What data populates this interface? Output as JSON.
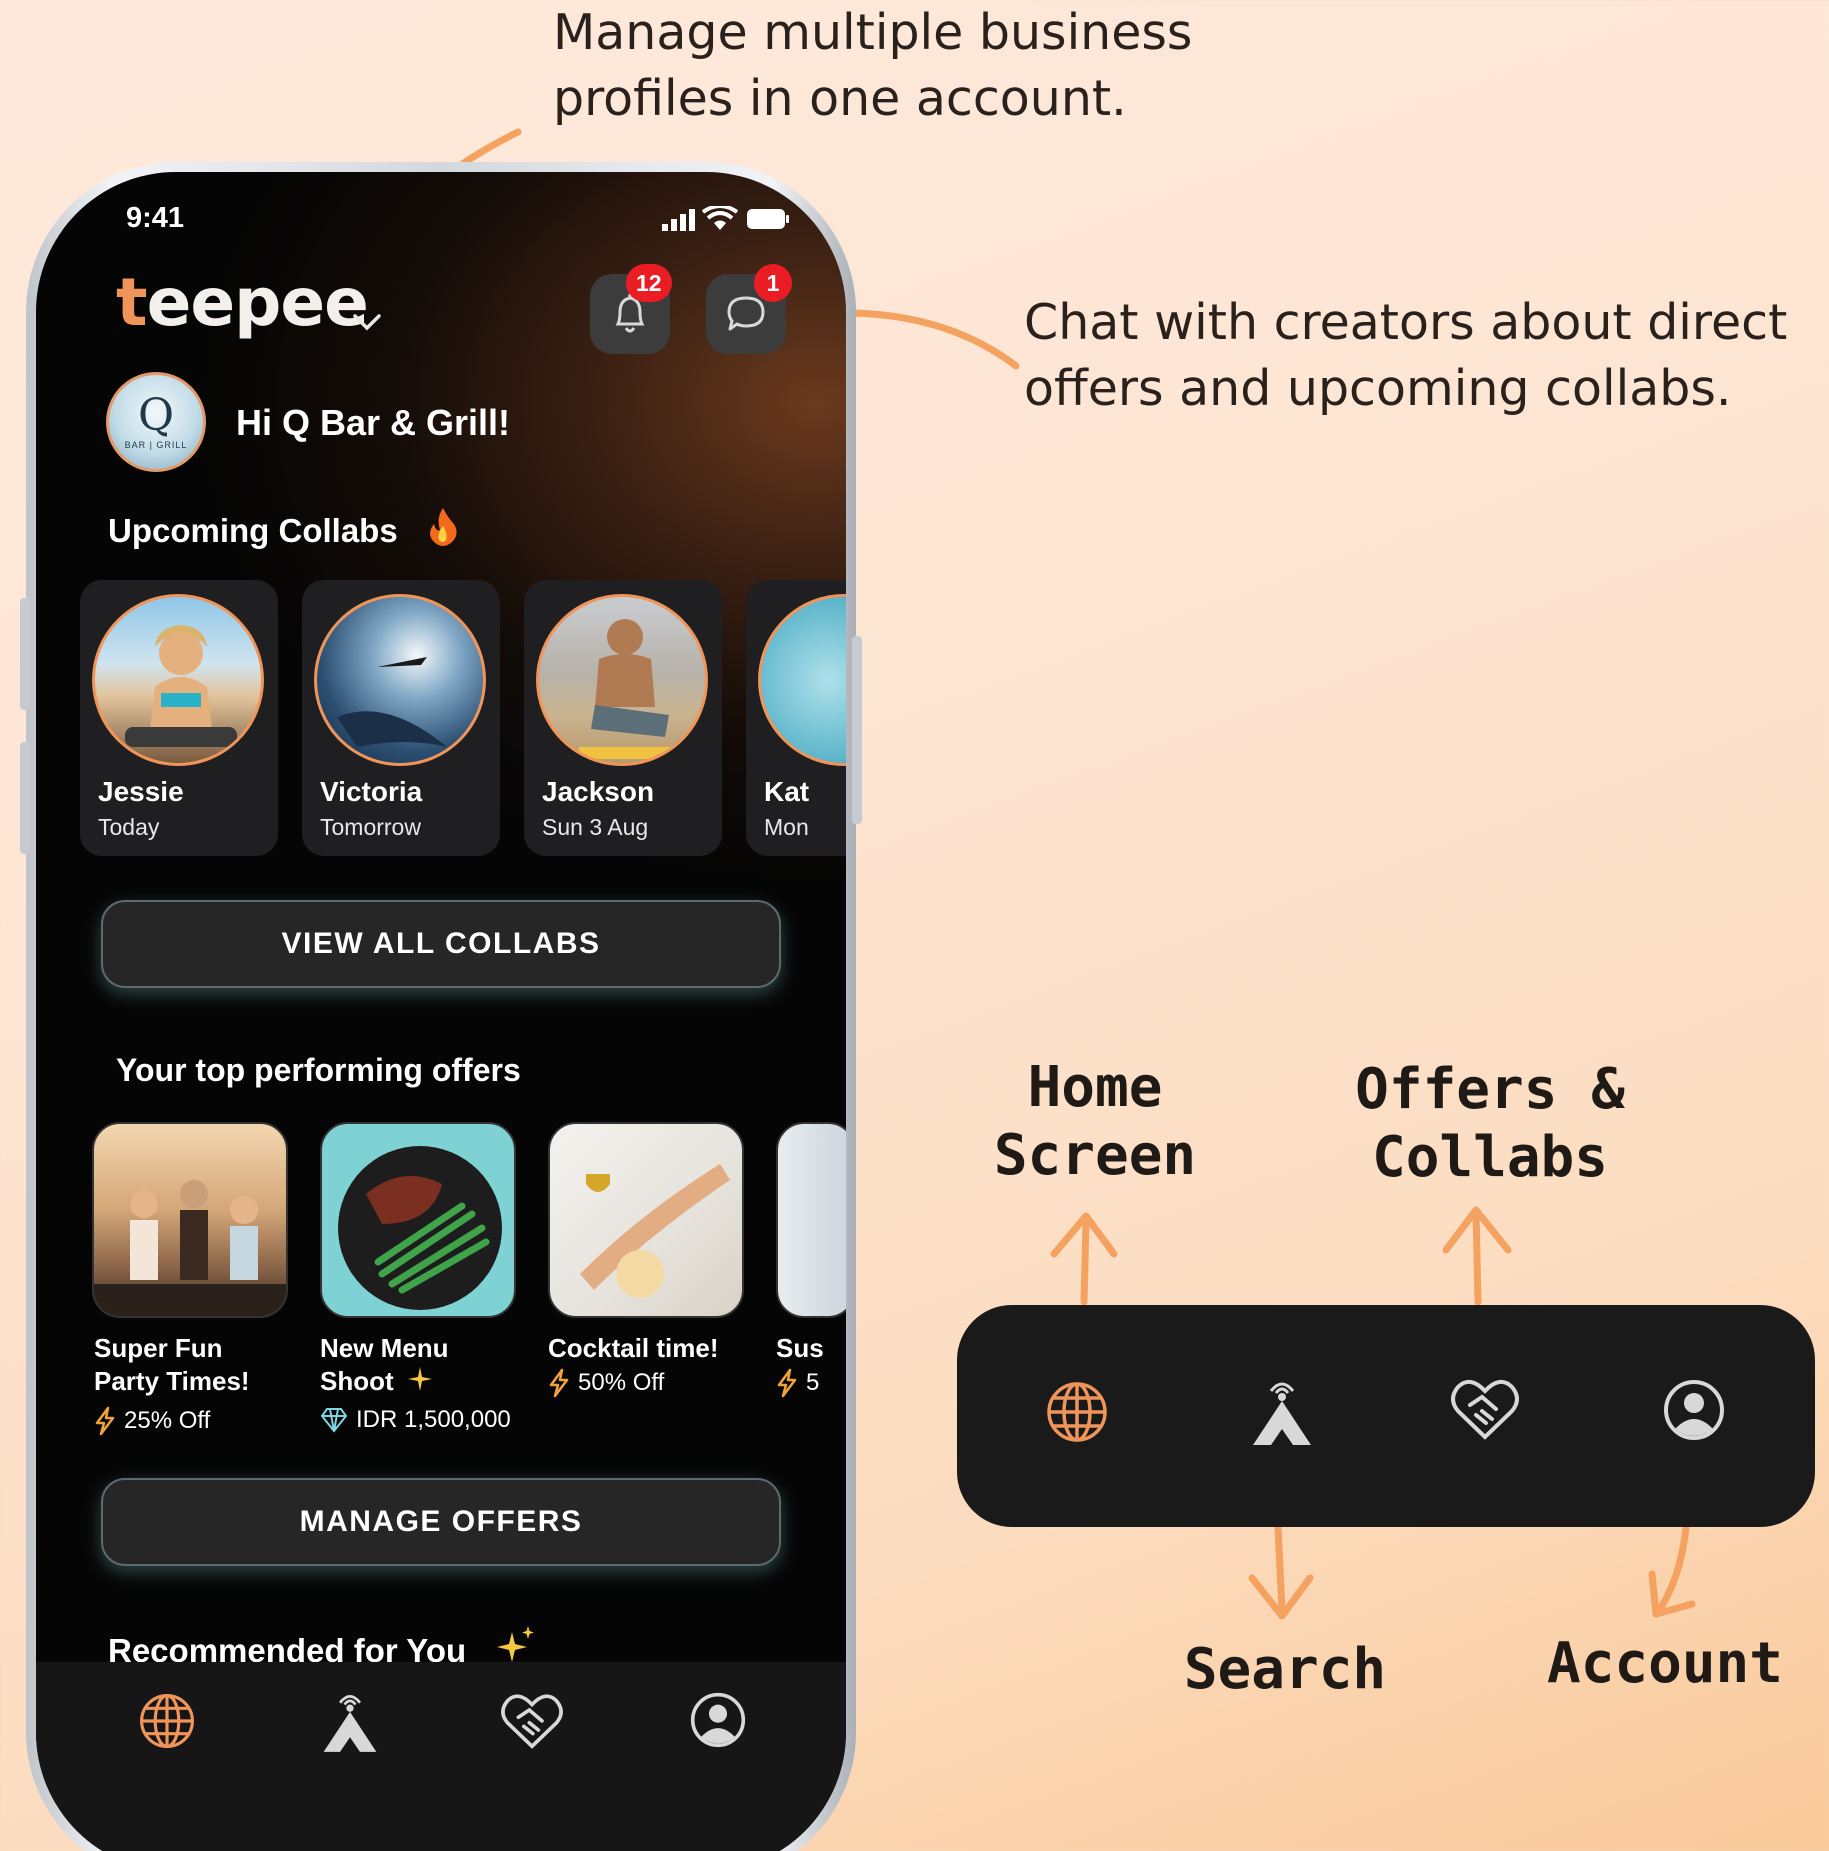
{
  "annotations": {
    "profiles": [
      "Manage multiple business",
      "profiles in one account."
    ],
    "chat": [
      "Chat with creators about  direct",
      "offers and upcoming collabs."
    ]
  },
  "nav_labels": {
    "home": [
      "Home",
      "Screen"
    ],
    "offers": [
      "Offers &",
      "Collabs"
    ],
    "search": "Search",
    "account": "Account"
  },
  "status_bar": {
    "time": "9:41"
  },
  "app": {
    "logo": "teepee",
    "notifications_count": "12",
    "messages_count": "1",
    "greeting": "Hi Q Bar & Grill!",
    "profile_avatar": {
      "letter": "Q",
      "sub": "BAR | GRILL"
    }
  },
  "upcoming_collabs": {
    "title": "Upcoming Collabs",
    "items": [
      {
        "name": "Jessie",
        "when": "Today"
      },
      {
        "name": "Victoria",
        "when": "Tomorrow"
      },
      {
        "name": "Jackson",
        "when": "Sun 3 Aug"
      },
      {
        "name": "Kat",
        "when": "Mon"
      }
    ],
    "view_all_label": "VIEW ALL COLLABS"
  },
  "top_offers": {
    "title": "Your top performing offers",
    "items": [
      {
        "title_line1": "Super Fun",
        "title_line2": "Party Times!",
        "meta": "25% Off",
        "meta_icon": "lightning-icon"
      },
      {
        "title_line1": "New Menu",
        "title_line2": "Shoot",
        "meta": "IDR 1,500,000",
        "meta_icon": "diamond-icon"
      },
      {
        "title_line1": "Cocktail time!",
        "title_line2": "",
        "meta": "50% Off",
        "meta_icon": "lightning-icon"
      },
      {
        "title_line1": "Sus",
        "title_line2": "",
        "meta": "5",
        "meta_icon": "lightning-icon"
      }
    ],
    "manage_label": "MANAGE OFFERS"
  },
  "recommended": {
    "title": "Recommended for You"
  },
  "colors": {
    "accent": "#f0955a",
    "badge": "#ea1d25",
    "nav_bg": "#1a1a1a"
  }
}
